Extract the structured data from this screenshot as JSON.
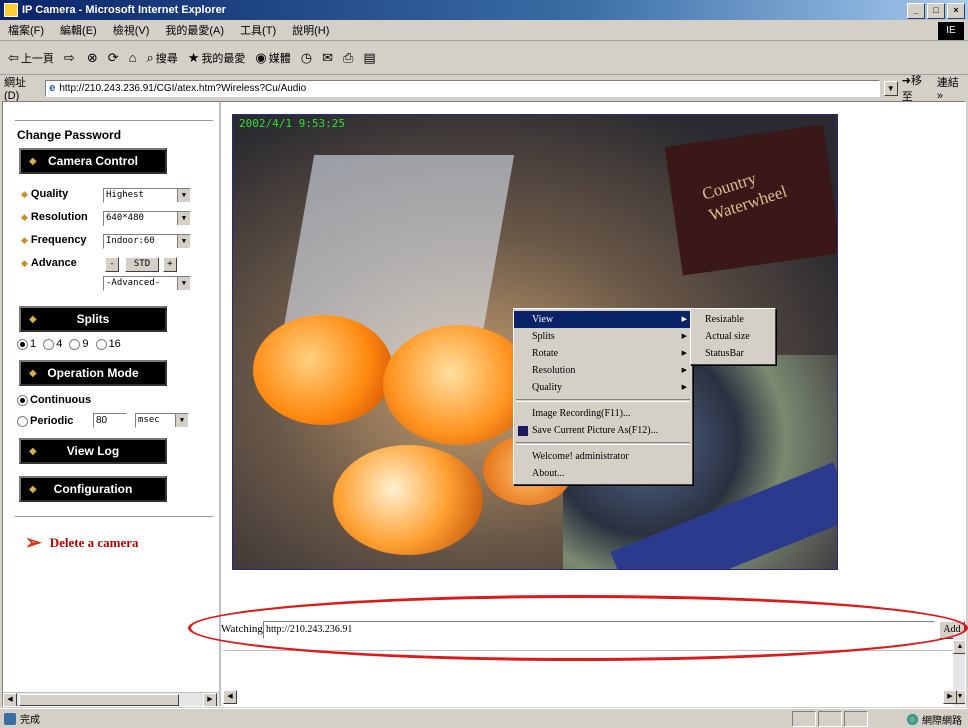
{
  "window": {
    "title": "IP Camera - Microsoft Internet Explorer",
    "min": "_",
    "max": "□",
    "close": "×",
    "logo": "IE"
  },
  "menubar": [
    "檔案(F)",
    "編輯(E)",
    "檢視(V)",
    "我的最愛(A)",
    "工具(T)",
    "說明(H)"
  ],
  "toolbar": {
    "back": "上一頁",
    "forward": "",
    "stop": "",
    "refresh": "",
    "home": "",
    "search": "搜尋",
    "favorites": "我的最愛",
    "media": "媒體",
    "history": "",
    "mail": "",
    "print": "",
    "edit": ""
  },
  "addressbar": {
    "label": "網址(D)",
    "url": "http://210.243.236.91/CGI/atex.htm?Wireless?Cu/Audio",
    "go": "移至",
    "links": "連結 »"
  },
  "left": {
    "change_password": "Change Password",
    "camera_control": "Camera Control",
    "quality_label": "Quality",
    "quality_value": "Highest",
    "resolution_label": "Resolution",
    "resolution_value": "640*480",
    "frequency_label": "Frequency",
    "frequency_value": "Indoor:60",
    "advance_label": "Advance",
    "adv_minus": "-",
    "adv_std": "STD",
    "adv_plus": "+",
    "advanced_value": "-Advanced-",
    "splits": "Splits",
    "split_1": "1",
    "split_4": "4",
    "split_9": "9",
    "split_16": "16",
    "operation_mode": "Operation Mode",
    "continuous": "Continuous",
    "periodic": "Periodic",
    "periodic_value": "80",
    "periodic_unit": "msec",
    "view_log": "View Log",
    "configuration": "Configuration",
    "delete_camera": "Delete a camera"
  },
  "video": {
    "timestamp": "2002/4/1 9:53:25",
    "box_text": "Country Waterwheel"
  },
  "context_menu": {
    "view": "View",
    "splits": "Splits",
    "rotate": "Rotate",
    "resolution": "Resolution",
    "quality": "Quality",
    "image_recording": "Image Recording(F11)...",
    "save_picture": "Save Current Picture As(F12)...",
    "welcome": "Welcome! administrator",
    "about": "About..."
  },
  "submenu": {
    "resizable": "Resizable",
    "actual_size": "Actual size",
    "status_bar": "StatusBar"
  },
  "watching": {
    "label": "Watching",
    "value": "http://210.243.236.91",
    "add": "Add"
  },
  "status": {
    "text": "完成",
    "zone": "網際網路"
  }
}
